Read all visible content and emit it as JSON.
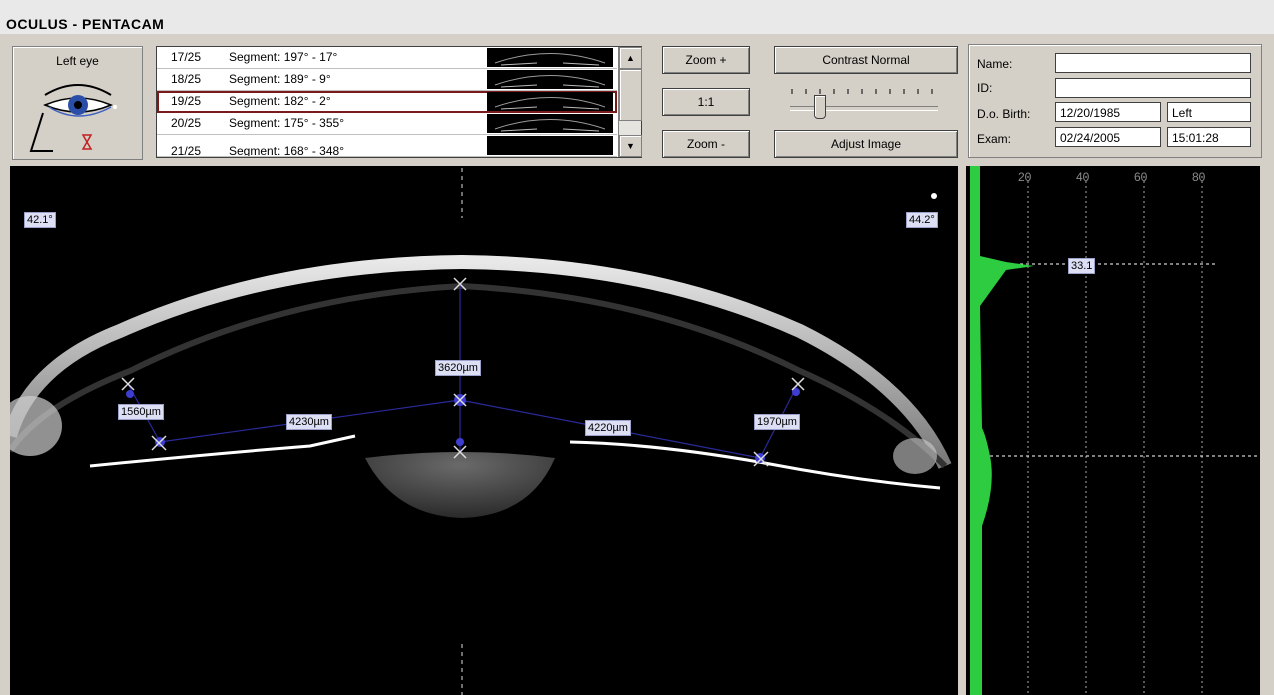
{
  "app": {
    "title": "OCULUS  -  PENTACAM"
  },
  "eye_panel": {
    "label": "Left eye"
  },
  "segments": [
    {
      "num": "17/25",
      "label": "Segment: 197° - 17°"
    },
    {
      "num": "18/25",
      "label": "Segment: 189° - 9°"
    },
    {
      "num": "19/25",
      "label": "Segment: 182° - 2°"
    },
    {
      "num": "20/25",
      "label": "Segment: 175° - 355°"
    },
    {
      "num": "21/25",
      "label": "Segment: 168° - 348°"
    }
  ],
  "selected_segment": "19/25",
  "zoom": {
    "zoom_in": "Zoom +",
    "reset": "1:1",
    "zoom_out": "Zoom -"
  },
  "contrast": {
    "normal_label": "Contrast Normal",
    "adjust_label": "Adjust Image",
    "level": 0.2
  },
  "patient": {
    "name_label": "Name:",
    "name_value": "",
    "id_label": "ID:",
    "id_value": "",
    "dob_label": "D.o. Birth:",
    "dob_value": "12/20/1985",
    "eye_value": "Left",
    "exam_label": "Exam:",
    "exam_date": "02/24/2005",
    "exam_time": "15:01:28"
  },
  "image": {
    "angle_left": "42.1°",
    "angle_right": "44.2°",
    "measurements": {
      "central": "3620µm",
      "left_depth": "1560µm",
      "left_span": "4230µm",
      "right_span": "4220µm",
      "right_depth": "1970µm"
    }
  },
  "densitometry": {
    "axis_ticks": [
      "20",
      "40",
      "60",
      "80"
    ],
    "peak_label": "33.1",
    "colors": {
      "bar": "#2ecc40",
      "background": "#000000"
    }
  }
}
